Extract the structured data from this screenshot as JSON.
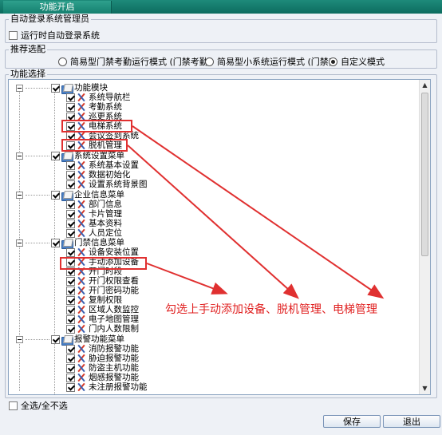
{
  "window": {
    "tab_title": "功能开启"
  },
  "auto_login": {
    "legend": "自动登录系统管理员",
    "checkbox_label": "运行时自动登录系统",
    "checked": false
  },
  "preset": {
    "legend": "推荐选配",
    "options": [
      {
        "label": "简易型门禁考勤运行模式 (门禁考勤)",
        "checked": false
      },
      {
        "label": "简易型小系统运行模式 (门禁)",
        "checked": false
      },
      {
        "label": "自定义模式",
        "checked": true
      }
    ]
  },
  "features": {
    "legend": "功能选择",
    "groups": [
      {
        "label": "功能模块",
        "items": [
          "系统导航栏",
          "考勤系统",
          "巡更系统",
          "电梯系统",
          "会议签到系统",
          "脱机管理"
        ]
      },
      {
        "label": "系统设置菜单",
        "items": [
          "系统基本设置",
          "数据初始化",
          "设置系统背景图"
        ]
      },
      {
        "label": "企业信息菜单",
        "items": [
          "部门信息",
          "卡片管理",
          "基本资料",
          "人员定位"
        ]
      },
      {
        "label": "门禁信息菜单",
        "items": [
          "设备安装位置",
          "手动添加设备",
          "开门时段",
          "开门权限查看",
          "开门密码功能",
          "复制权限",
          "区域人数监控",
          "电子地图管理",
          "门内人数限制"
        ]
      },
      {
        "label": "报警功能菜单",
        "items": [
          "消防报警功能",
          "胁迫报警功能",
          "防盗主机功能",
          "烟感报警功能",
          "未注册报警功能"
        ]
      }
    ]
  },
  "select_all_label": "全选/全不选",
  "buttons": {
    "save": "保存",
    "exit": "退出"
  },
  "annotation": "勾选上手动添加设备、脱机管理、电梯管理",
  "colors": {
    "highlight": "#e03030",
    "title_bar": "#0c6c5f"
  }
}
